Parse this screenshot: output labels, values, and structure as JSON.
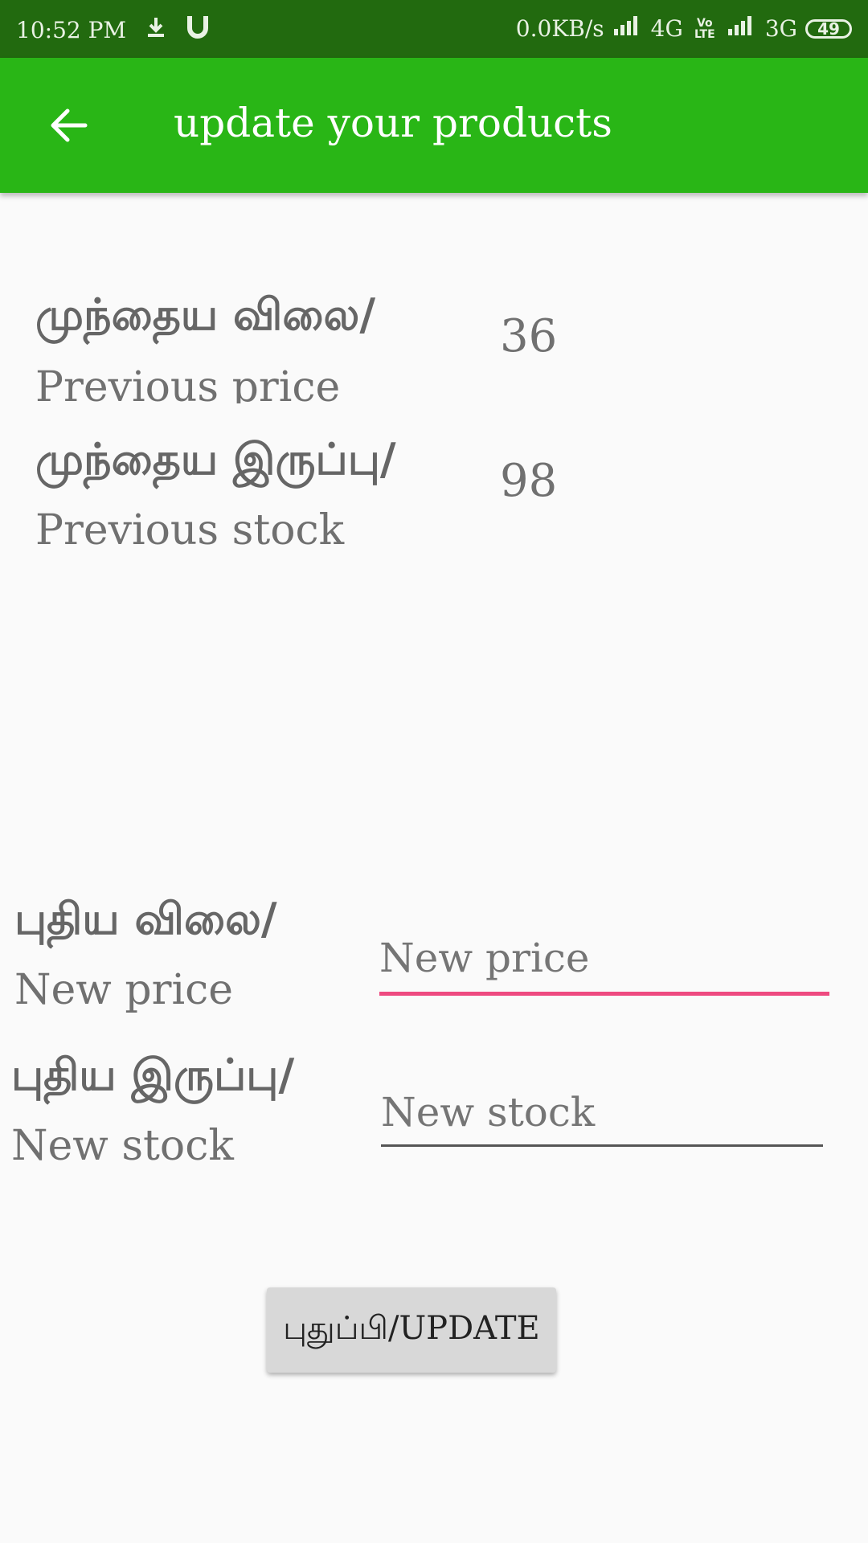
{
  "status_bar": {
    "time": "10:52 PM",
    "net_speed": "0.0KB/s",
    "network_1": "4G",
    "volte": "Vo LTE",
    "network_2": "3G",
    "battery": "49",
    "icons": [
      "download-icon",
      "magnet-icon",
      "signal-icon",
      "volte-icon",
      "battery-icon"
    ]
  },
  "app_bar": {
    "title": "update your products",
    "back_icon": "arrow-back-icon",
    "color": "#29b616"
  },
  "previous": {
    "price_label_ta": "முந்தைய விலை/",
    "price_label_en": "Previous price",
    "price_value": "36",
    "stock_label_ta": "முந்தைய இருப்பு/",
    "stock_label_en": "Previous stock",
    "stock_value": "98"
  },
  "new_entry": {
    "price_label_ta": "புதிய விலை/",
    "price_label_en": "New price",
    "price_placeholder": "New price",
    "price_value": "",
    "stock_label_ta": "புதிய இருப்பு/",
    "stock_label_en": "New stock",
    "stock_placeholder": "New stock",
    "stock_value": ""
  },
  "actions": {
    "update_label": "புதுப்பி/UPDATE"
  },
  "colors": {
    "status_bar": "#226a0f",
    "accent_active": "#ee4a80",
    "background": "#fafafa"
  }
}
